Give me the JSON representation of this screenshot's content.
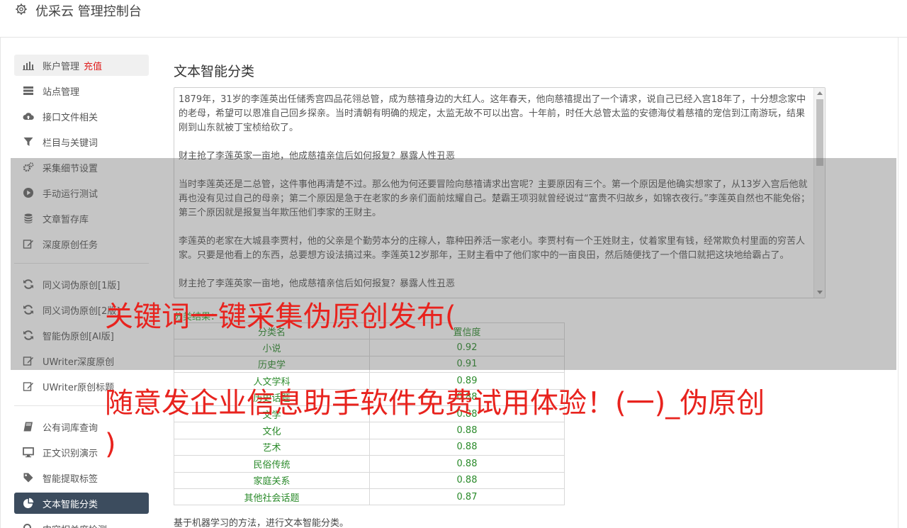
{
  "header": {
    "title": "优采云 管理控制台",
    "icon": "gear-icon"
  },
  "sidebar": {
    "items": [
      {
        "label": "账户管理",
        "extra": "充值",
        "icon": "bar-chart-icon"
      },
      {
        "label": "站点管理",
        "icon": "server-icon"
      },
      {
        "label": "接口文件相关",
        "icon": "cloud-upload-icon"
      },
      {
        "label": "栏目与关键词",
        "icon": "filter-icon"
      },
      {
        "label": "采集细节设置",
        "icon": "gears-icon"
      },
      {
        "label": "手动运行测试",
        "icon": "play-circle-icon"
      },
      {
        "label": "文章暂存库",
        "icon": "database-icon"
      },
      {
        "label": "深度原创任务",
        "icon": "edit-icon"
      },
      {
        "label": "同义词伪原创[1版]",
        "icon": "refresh-icon"
      },
      {
        "label": "同义词伪原创[2版]",
        "icon": "refresh-icon"
      },
      {
        "label": "智能伪原创[AI版]",
        "icon": "refresh-icon"
      },
      {
        "label": "UWriter深度原创",
        "icon": "edit-icon"
      },
      {
        "label": "UWriter原创标题",
        "icon": "edit-icon"
      },
      {
        "label": "公有词库查询",
        "icon": "book-icon"
      },
      {
        "label": "正文识别演示",
        "icon": "monitor-icon"
      },
      {
        "label": "智能提取标签",
        "icon": "tag-icon"
      },
      {
        "label": "文本智能分类",
        "icon": "pie-chart-icon"
      },
      {
        "label": "内容相关度检测",
        "icon": "search-icon"
      }
    ]
  },
  "main": {
    "title": "文本智能分类",
    "article": [
      "1879年，31岁的李莲英出任储秀宫四品花翎总管，成为慈禧身边的大红人。这年春天，他向慈禧提出了一个请求，说自己已经入宫18年了，十分想念家中的老母，希望可以恩准自己回乡探亲。当时清朝有明确的规定，太监无故不可以出宫。十年前，时任大总管太监的安德海仗着慈禧的宠信到江南游玩，结果刚到山东就被丁宝桢给砍了。",
      "财主抢了李莲英家一亩地，他成慈禧亲信后如何报复？暴露人性丑恶",
      "当时李莲英还是二总管，这件事他再清楚不过。那么他为何还要冒险向慈禧请求出宫呢？主要原因有三个。第一个原因是他确实想家了，从13岁入宫后他就再也没有见过自己的母亲；第二个原因是急于在老家的乡亲们面前炫耀自己。楚霸王项羽就曾经说过“富贵不归故乡，如锦衣夜行。”李莲英自然也不能免俗；第三个原因就是报复当年欺压他们李家的王财主。",
      "李莲英的老家在大城县李贾村，他的父亲是个勤劳本分的庄稼人，靠种田养活一家老小。李贾村有一个王姓财主，仗着家里有钱，经常欺负村里面的穷苦人家。只要是他看上的东西，总要想方设法搞过来。李莲英12岁那年，王财主看中了他们家中的一亩良田，然后随便找了一个借口就把这块地给霸占了。",
      "财主抢了李莲英家一亩地，他成慈禧亲信后如何报复？暴露人性丑恶"
    ],
    "result_label": "分类结果：",
    "table": {
      "headers": [
        "分类名",
        "置信度"
      ],
      "rows": [
        [
          "小说",
          "0.92"
        ],
        [
          "历史学",
          "0.91"
        ],
        [
          "人文学科",
          "0.89"
        ],
        [
          "历史话题",
          "0.88"
        ],
        [
          "文学",
          "0.88"
        ],
        [
          "文化",
          "0.88"
        ],
        [
          "艺术",
          "0.88"
        ],
        [
          "民俗传统",
          "0.88"
        ],
        [
          "家庭关系",
          "0.88"
        ],
        [
          "其他社会话题",
          "0.87"
        ]
      ]
    },
    "footnote": "基于机器学习的方法，进行文本智能分类。"
  },
  "overlay": {
    "line1": "关键词一键采集伪原创发布(",
    "line2": "随意发企业信息助手软件免费试用体验！(一)_伪原创",
    "line3": ")"
  },
  "colors": {
    "accent_dark": "#3c4c5e",
    "green": "#2a8a2a",
    "red": "#e8231e"
  }
}
